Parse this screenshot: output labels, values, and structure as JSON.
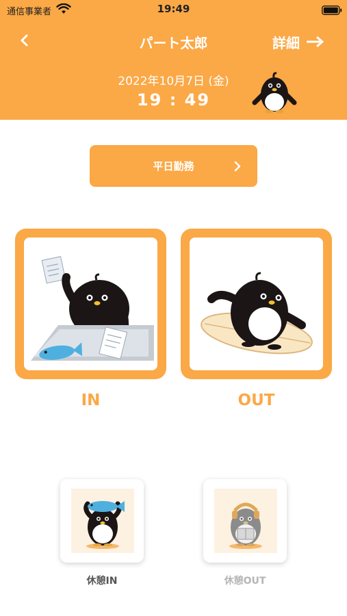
{
  "status_bar": {
    "carrier": "通信事業者",
    "time": "19:49"
  },
  "header": {
    "title": "パート太郎",
    "detail_label": "詳細",
    "date": "2022年10月7日 (金)",
    "time": "19 : 49",
    "background_color": "#fba846"
  },
  "shift": {
    "label": "平日勤務"
  },
  "clock_buttons": {
    "in_label": "IN",
    "out_label": "OUT"
  },
  "break_buttons": {
    "in_label": "休憩IN",
    "out_label": "休憩OUT",
    "out_disabled": true
  },
  "icons": {
    "back": "chevron-left-icon",
    "detail": "arrow-right-icon",
    "shift": "chevron-right-icon"
  }
}
